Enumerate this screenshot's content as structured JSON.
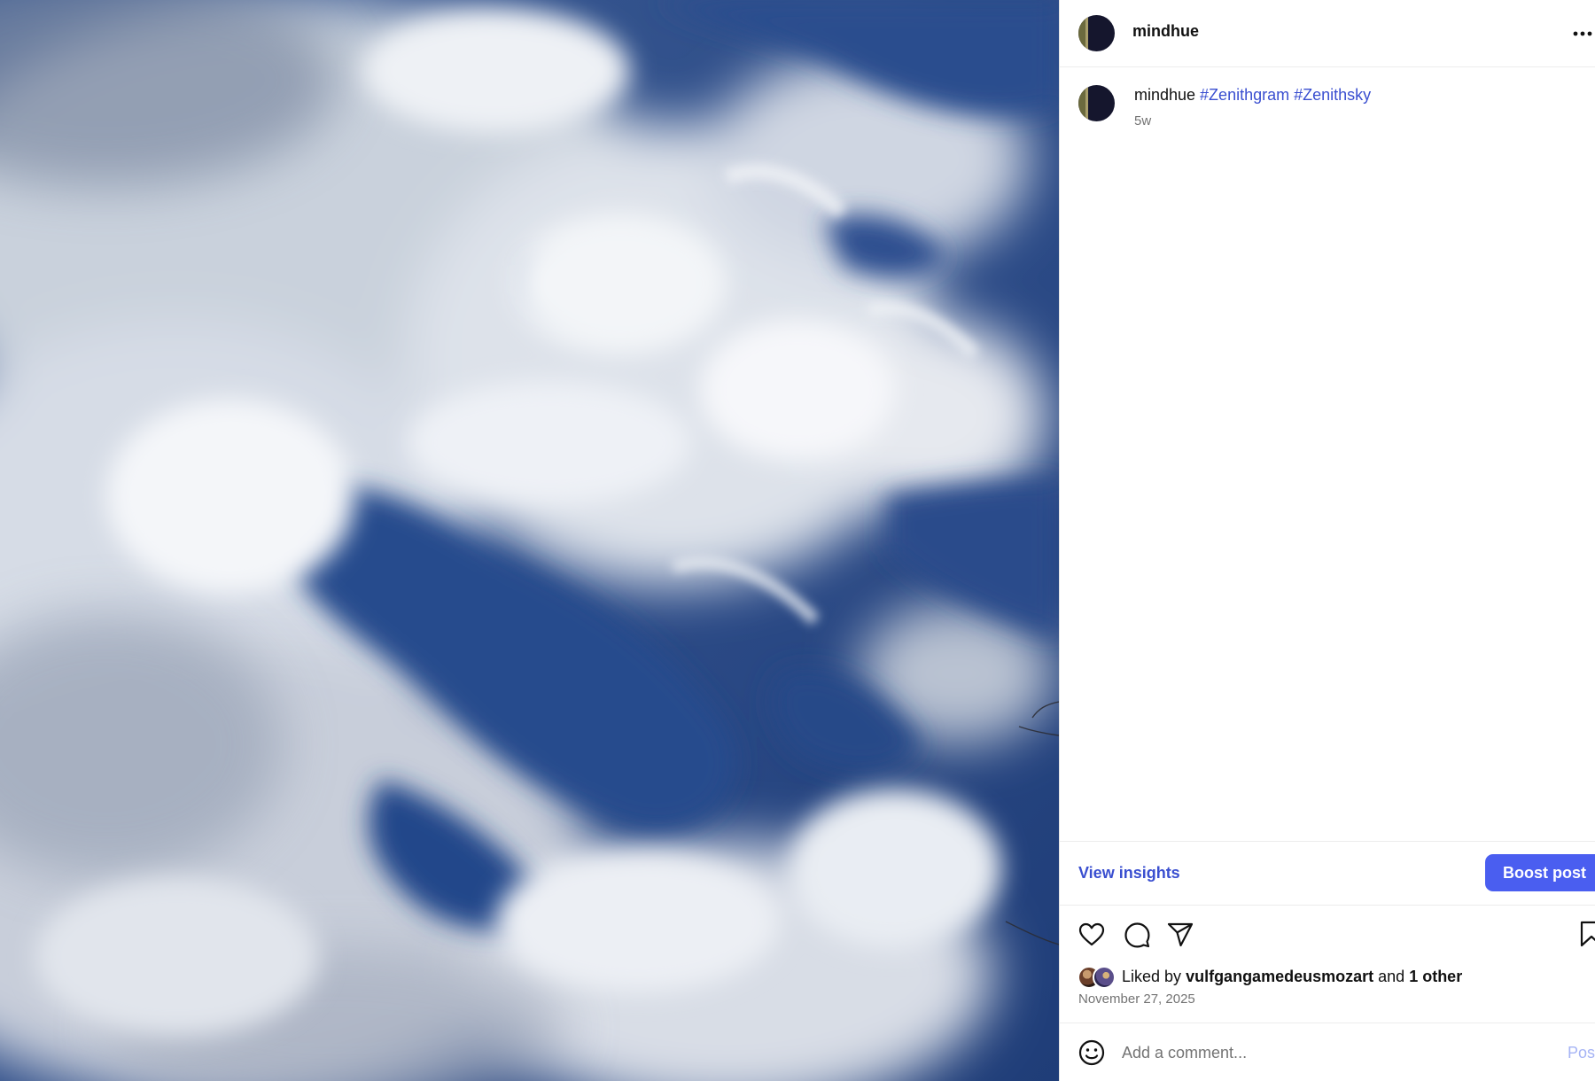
{
  "post": {
    "username": "mindhue",
    "more_icon": "more-horizontal-icon",
    "photo_description_icon": "cloudy-sky-photo"
  },
  "caption": {
    "username": "mindhue",
    "hashtags": [
      "#Zenithgram",
      "#Zenithsky"
    ],
    "age": "5w"
  },
  "actions": {
    "insights_label": "View insights",
    "boost_label": "Boost post",
    "icons": [
      "heart-icon",
      "comment-icon",
      "share-icon",
      "bookmark-icon"
    ]
  },
  "likes": {
    "prefix": "Liked by",
    "user": "vulfgangamedeusmozart",
    "joiner": "and",
    "others": "1 other",
    "date": "November 27, 2025"
  },
  "comment_box": {
    "placeholder": "Add a comment...",
    "post_label": "Post",
    "emoji_icon": "emoji-icon"
  },
  "colors": {
    "link_blue": "#3a4fd0",
    "boost_bg": "#4a5ef0",
    "post_disabled": "#a6b4f5",
    "sky_blue": "#2f4f88"
  }
}
